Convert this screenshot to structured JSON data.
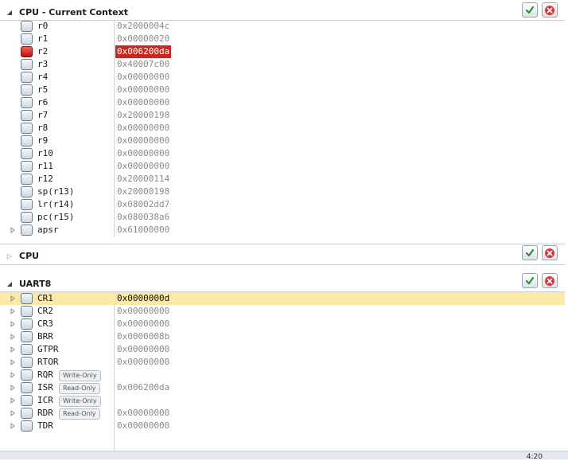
{
  "sections": {
    "context": {
      "title": "CPU - Current Context",
      "rows": [
        {
          "name": "r0",
          "value": "0x2000004c",
          "changed": false
        },
        {
          "name": "r1",
          "value": "0x00000020",
          "changed": false
        },
        {
          "name": "r2",
          "value": "0x006200da",
          "changed": true
        },
        {
          "name": "r3",
          "value": "0x40007c00",
          "changed": false
        },
        {
          "name": "r4",
          "value": "0x00000000",
          "changed": false
        },
        {
          "name": "r5",
          "value": "0x00000000",
          "changed": false
        },
        {
          "name": "r6",
          "value": "0x00000000",
          "changed": false
        },
        {
          "name": "r7",
          "value": "0x20000198",
          "changed": false
        },
        {
          "name": "r8",
          "value": "0x00000000",
          "changed": false
        },
        {
          "name": "r9",
          "value": "0x00000000",
          "changed": false
        },
        {
          "name": "r10",
          "value": "0x00000000",
          "changed": false
        },
        {
          "name": "r11",
          "value": "0x00000000",
          "changed": false
        },
        {
          "name": "r12",
          "value": "0x20000114",
          "changed": false
        },
        {
          "name": "sp(r13)",
          "value": "0x20000198",
          "changed": false
        },
        {
          "name": "lr(r14)",
          "value": "0x08002dd7",
          "changed": false
        },
        {
          "name": "pc(r15)",
          "value": "0x080038a6",
          "changed": false
        },
        {
          "name": "apsr",
          "value": "0x61000000",
          "changed": false,
          "expandable": true
        }
      ]
    },
    "cpu": {
      "title": "CPU"
    },
    "uart": {
      "title": "UART8",
      "rows": [
        {
          "name": "CR1",
          "value": "0x0000000d",
          "selected": true
        },
        {
          "name": "CR2",
          "value": "0x00000000"
        },
        {
          "name": "CR3",
          "value": "0x00000000"
        },
        {
          "name": "BRR",
          "value": "0x0000008b"
        },
        {
          "name": "GTPR",
          "value": "0x00000000"
        },
        {
          "name": "RTOR",
          "value": "0x00000000"
        },
        {
          "name": "RQR",
          "value": "",
          "badge": "Write-Only"
        },
        {
          "name": "ISR",
          "value": "0x006200da",
          "badge": "Read-Only"
        },
        {
          "name": "ICR",
          "value": "",
          "badge": "Write-Only"
        },
        {
          "name": "RDR",
          "value": "0x00000000",
          "badge": "Read-Only"
        },
        {
          "name": "TDR",
          "value": "0x00000000"
        }
      ]
    }
  },
  "icons": {
    "pin_button": "pin-icon",
    "close_button": "close-icon",
    "expand_open": "triangle-expanded-icon",
    "expand_closed": "triangle-collapsed-icon"
  },
  "colors": {
    "changed_bg": "#c8281e",
    "selected_row": "#fbe9a8",
    "value_text": "#8a8a8a",
    "active_checkbox": "#d02020"
  },
  "status": {
    "time": "4:20"
  }
}
